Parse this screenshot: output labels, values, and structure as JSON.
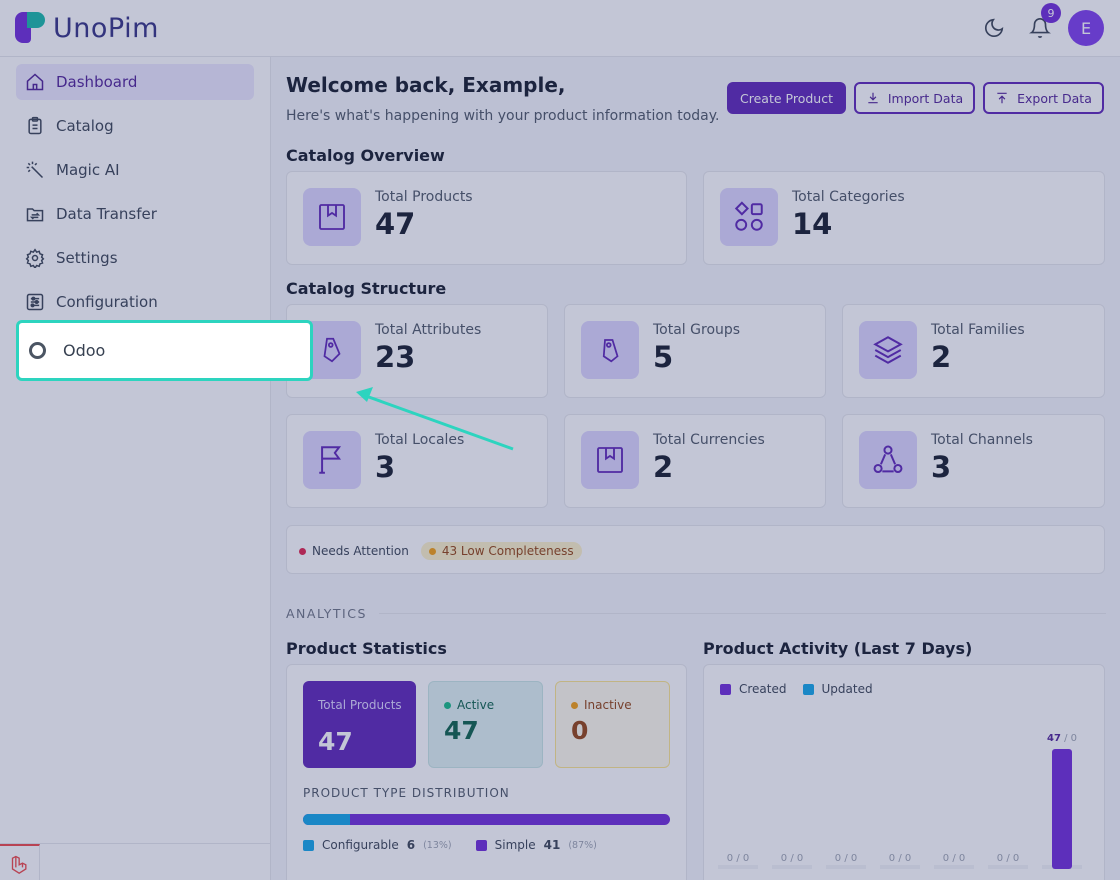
{
  "app": {
    "name": "UnoPim",
    "notification_count": "9",
    "user_initial": "E"
  },
  "sidebar": {
    "items": [
      {
        "label": "Dashboard",
        "icon": "home-icon"
      },
      {
        "label": "Catalog",
        "icon": "clipboard-icon"
      },
      {
        "label": "Magic AI",
        "icon": "magic-wand-icon"
      },
      {
        "label": "Data Transfer",
        "icon": "folder-transfer-icon"
      },
      {
        "label": "Settings",
        "icon": "gear-icon"
      },
      {
        "label": "Configuration",
        "icon": "sliders-icon"
      }
    ],
    "highlight": {
      "label": "Odoo",
      "icon": "circle-icon"
    }
  },
  "header": {
    "welcome": "Welcome back, Example,",
    "subtitle": "Here's what's happening with your product information today.",
    "create_label": "Create Product",
    "import_label": "Import Data",
    "export_label": "Export Data"
  },
  "overview": {
    "title": "Catalog Overview",
    "cards": [
      {
        "label": "Total Products",
        "value": "47"
      },
      {
        "label": "Total Categories",
        "value": "14"
      }
    ]
  },
  "structure": {
    "title": "Catalog Structure",
    "cards": [
      {
        "label": "Total Attributes",
        "value": "23"
      },
      {
        "label": "Total Groups",
        "value": "5"
      },
      {
        "label": "Total Families",
        "value": "2"
      },
      {
        "label": "Total Locales",
        "value": "3"
      },
      {
        "label": "Total Currencies",
        "value": "2"
      },
      {
        "label": "Total Channels",
        "value": "3"
      }
    ]
  },
  "attention": {
    "needs": "Needs Attention",
    "low": "43 Low Completeness"
  },
  "analytics": {
    "label": "ANALYTICS",
    "stats": {
      "title": "Product Statistics",
      "total_label": "Total Products",
      "total_value": "47",
      "active_label": "Active",
      "active_value": "47",
      "inactive_label": "Inactive",
      "inactive_value": "0",
      "dist_title": "PRODUCT TYPE DISTRIBUTION",
      "configurable_label": "Configurable",
      "configurable_value": "6",
      "configurable_pct": "(13%)",
      "simple_label": "Simple",
      "simple_value": "41",
      "simple_pct": "(87%)"
    },
    "activity": {
      "title": "Product Activity (Last 7 Days)",
      "created_label": "Created",
      "updated_label": "Updated"
    }
  },
  "colors": {
    "accent": "#5b21b6",
    "teal": "#2dd4bf",
    "created": "#6d28d9",
    "updated": "#0ea5e9"
  },
  "chart_data": {
    "type": "bar",
    "categories": [
      "",
      "",
      "",
      "",
      "",
      "",
      ""
    ],
    "series": [
      {
        "name": "Created",
        "values": [
          0,
          0,
          0,
          0,
          0,
          0,
          47
        ]
      },
      {
        "name": "Updated",
        "values": [
          0,
          0,
          0,
          0,
          0,
          0,
          0
        ]
      }
    ],
    "ylim": [
      0,
      47
    ],
    "legend": "top-left"
  }
}
